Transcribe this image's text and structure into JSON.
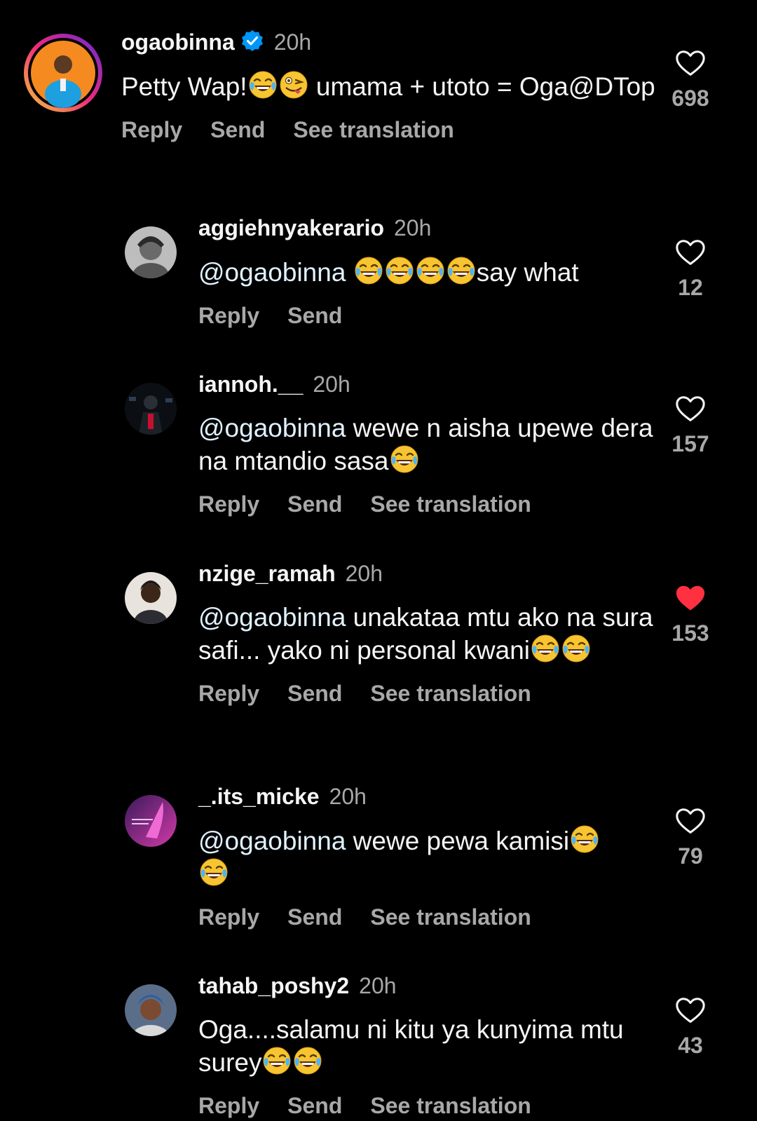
{
  "actions": {
    "reply": "Reply",
    "send": "Send",
    "see_translation": "See translation"
  },
  "colors": {
    "background": "#000000",
    "text": "#f5f5f5",
    "secondary": "#a8a8a8",
    "liked_heart": "#ff3040",
    "verified_badge": "#0095f6"
  },
  "comments": [
    {
      "username": "ogaobinna",
      "verified": true,
      "time": "20h",
      "text_line1": "Petty Wap!",
      "text_emoji": "😂😜",
      "text_rest": " umama + utoto = Oga@DTop",
      "likes": "698",
      "liked": false
    },
    {
      "username": "aggiehnyakerario",
      "time": "20h",
      "mention": "@ogaobinna",
      "text_before_emoji": " ",
      "emoji": "😂😂😂😂",
      "text_after_emoji": "say what",
      "likes": "12",
      "liked": false
    },
    {
      "username": "iannoh.__",
      "time": "20h",
      "mention": "@ogaobinna",
      "text_before_emoji": " wewe n aisha upewe dera na mtandio sasa",
      "emoji": "😂",
      "text_after_emoji": "",
      "likes": "157",
      "liked": false
    },
    {
      "username": "nzige_ramah",
      "time": "20h",
      "mention": "@ogaobinna",
      "text_before_emoji": " unakataa mtu ako na sura safi... yako ni personal kwani",
      "emoji": "😂😂",
      "text_after_emoji": "",
      "likes": "153",
      "liked": true
    },
    {
      "username": "_.its_micke",
      "time": "20h",
      "mention": "@ogaobinna",
      "text_before_emoji": " wewe pewa kamisi",
      "emoji": "😂😂",
      "text_after_emoji": "",
      "likes": "79",
      "liked": false
    },
    {
      "username": "tahab_poshy2",
      "time": "20h",
      "mention": "",
      "text_before_emoji": "Oga....salamu ni kitu ya kunyima mtu surey",
      "emoji": "😂😂",
      "text_after_emoji": "",
      "likes": "43",
      "liked": false
    }
  ]
}
